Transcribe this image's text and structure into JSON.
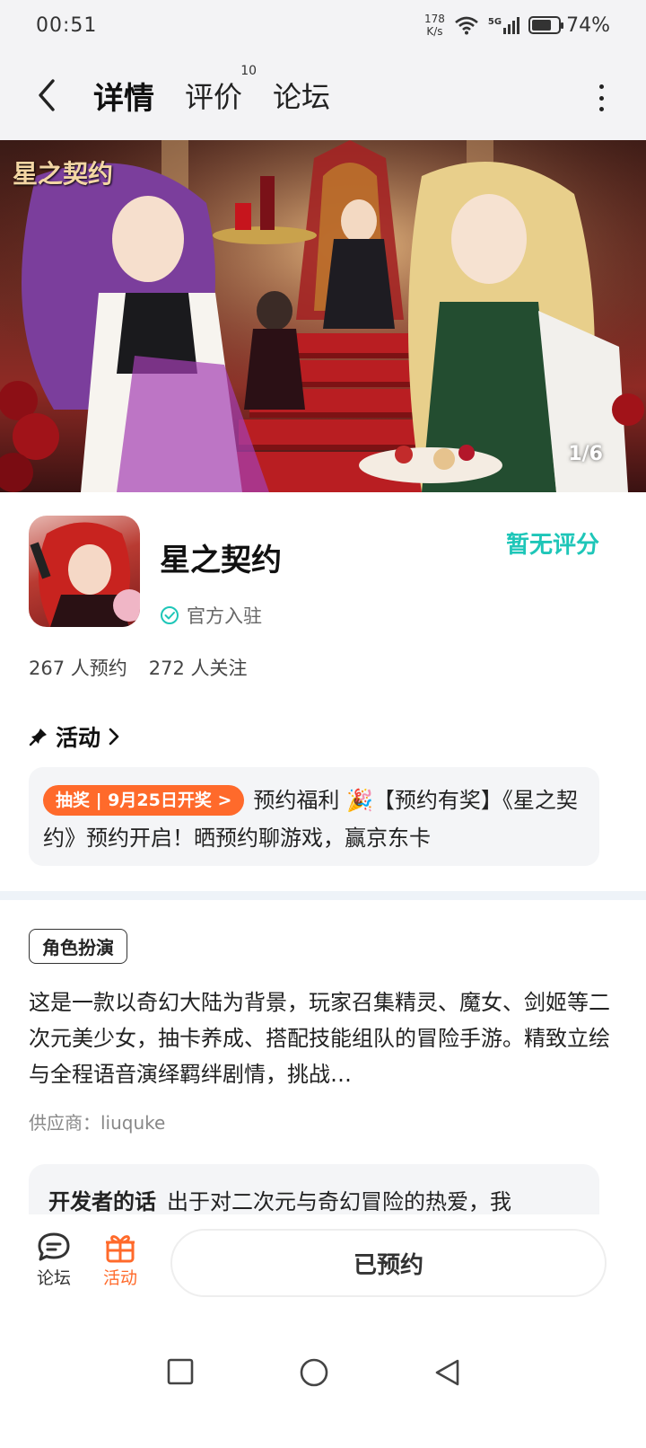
{
  "status_bar": {
    "time": "00:51",
    "net_speed_value": "178",
    "net_speed_unit": "K/s",
    "signal_label": "5G",
    "battery_percent": "74%",
    "battery_level": 0.74
  },
  "nav": {
    "tabs": [
      {
        "label": "详情",
        "active": true
      },
      {
        "label": "评价",
        "badge": "10"
      },
      {
        "label": "论坛"
      }
    ]
  },
  "banner": {
    "logo_text": "星之契约",
    "counter": "1/6"
  },
  "app": {
    "name": "星之契约",
    "verified_label": "官方入驻",
    "rating": "暂无评分",
    "reservations": "267 人预约",
    "followers": "272 人关注"
  },
  "activity": {
    "header": "活动",
    "tag": "抽奖 | 9月25日开奖 >",
    "text_prefix": "预约福利 🎉",
    "text_body": "【预约有奖】《星之契约》预约开启！晒预约聊游戏，赢京东卡"
  },
  "description": {
    "genre": "角色扮演",
    "text": "这是一款以奇幻大陆为背景，玩家召集精灵、魔女、剑姬等二次元美少女，抽卡养成、搭配技能组队的冒险手游。精致立绘与全程语音演绎羁绊剧情，挑战…",
    "supplier": "供应商：liuquke",
    "dev_label": "开发者的话",
    "dev_text": "出于对二次元与奇幻冒险的热爱，我"
  },
  "bottom_bar": {
    "forum_label": "论坛",
    "events_label": "活动",
    "reserved_label": "已预约"
  },
  "colors": {
    "accent_teal": "#20d1c1",
    "rating_teal": "#1ec6b8",
    "orange": "#ff6a2b"
  }
}
